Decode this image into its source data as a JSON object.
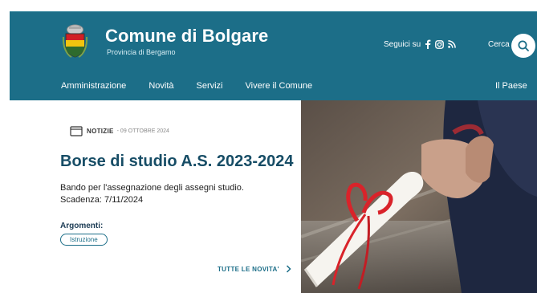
{
  "header": {
    "title": "Comune di Bolgare",
    "subtitle": "Provincia di Bergamo",
    "social_label": "Seguici su",
    "search_label": "Cerca",
    "icons": [
      "facebook-icon",
      "instagram-icon",
      "rss-icon",
      "search-icon"
    ],
    "brand_color": "#1c6e88"
  },
  "nav": {
    "items": [
      "Amministrazione",
      "Novità",
      "Servizi",
      "Vivere il Comune"
    ],
    "right": "Il Paese"
  },
  "card": {
    "category": "NOTIZIE",
    "date": "- 09 OTTOBRE 2024",
    "headline": "Borse di studio A.S. 2023-2024",
    "description": "Bando per l'assegnazione degli assegni studio. Scadenza: 7/11/2024",
    "topics_label": "Argomenti:",
    "topic_chip": "Istruzione",
    "all_news": "TUTTE LE NOVITA'"
  }
}
